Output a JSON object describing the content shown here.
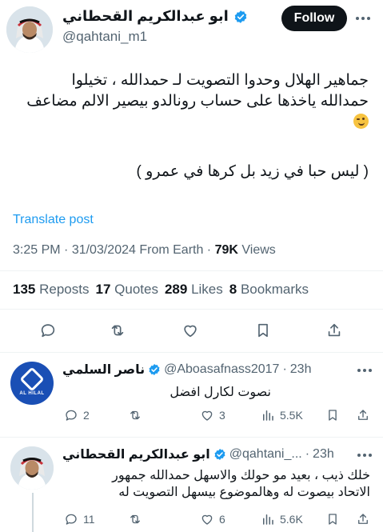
{
  "main_tweet": {
    "display_name": "ابو عبدالكريم القحطاني",
    "handle": "@qahtani_m1",
    "follow_label": "Follow",
    "text_lines": [
      "جماهير الهلال وحدوا التصويت لـ حمدالله ، تخيلوا",
      "حمدالله ياخذها على حساب رونالدو بيصير الالم مضاعف"
    ],
    "quote_line": "( ليس حبا في زيد بل كرها في عمرو )",
    "translate_label": "Translate post",
    "time": "3:25 PM",
    "date": "31/03/2024",
    "source": "From Earth",
    "views_count": "79K",
    "views_label": "Views",
    "stats": [
      {
        "count": "135",
        "label": "Reposts"
      },
      {
        "count": "17",
        "label": "Quotes"
      },
      {
        "count": "289",
        "label": "Likes"
      },
      {
        "count": "8",
        "label": "Bookmarks"
      }
    ],
    "actions": [
      "reply-icon",
      "repost-icon",
      "like-icon",
      "bookmark-icon",
      "share-icon"
    ]
  },
  "replies": [
    {
      "display_name": "ناصر السلمي",
      "handle": "@Aboasafnass2017",
      "time": "23h",
      "avatar_caption": "AL HILAL",
      "text_lines": [
        "نصوت لكارل افضل"
      ],
      "counts": {
        "replies": "2",
        "reposts": "",
        "likes": "3",
        "views": "5.5K"
      }
    },
    {
      "display_name": "ابو عبدالكريم القحطاني",
      "handle": "@qahtani_...",
      "time": "23h",
      "text_lines": [
        "خلك ذيب ، بعيد مو حولك والاسهل حمدالله جمهور",
        "الاتحاد بيصوت له وهالموضوع بيسهل التصويت له"
      ],
      "counts": {
        "replies": "11",
        "reposts": "",
        "likes": "6",
        "views": "5.6K"
      }
    }
  ],
  "colors": {
    "accent": "#1d9bf0",
    "text": "#0f1419",
    "muted": "#536471",
    "hilal_blue": "#1a4fb5"
  }
}
